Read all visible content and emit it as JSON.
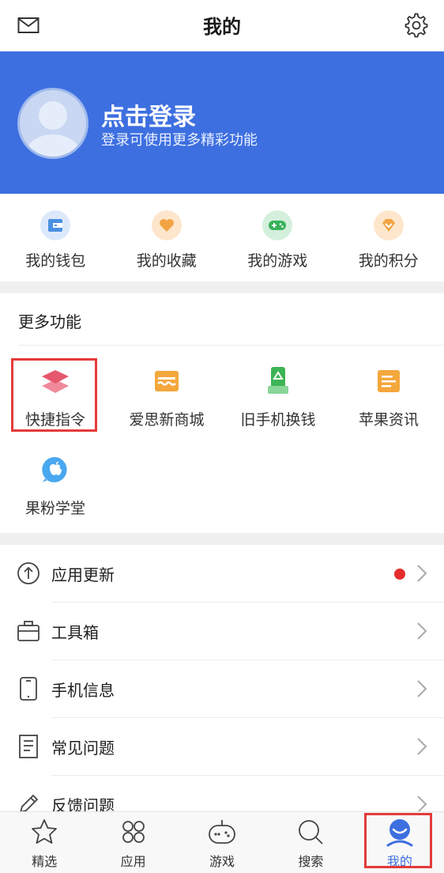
{
  "topbar": {
    "title": "我的"
  },
  "header": {
    "login_title": "点击登录",
    "login_subtitle": "登录可使用更多精彩功能"
  },
  "quick": [
    {
      "label": "我的钱包",
      "icon": "wallet-icon"
    },
    {
      "label": "我的收藏",
      "icon": "heart-icon"
    },
    {
      "label": "我的游戏",
      "icon": "gamepad-icon"
    },
    {
      "label": "我的积分",
      "icon": "points-icon"
    }
  ],
  "more": {
    "title": "更多功能",
    "items": [
      {
        "label": "快捷指令",
        "icon": "shortcuts-layers-icon"
      },
      {
        "label": "爱思新商城",
        "icon": "store-icon"
      },
      {
        "label": "旧手机换钱",
        "icon": "recycle-phone-icon"
      },
      {
        "label": "苹果资讯",
        "icon": "news-icon"
      },
      {
        "label": "果粉学堂",
        "icon": "apple-school-icon"
      }
    ]
  },
  "list": [
    {
      "label": "应用更新",
      "icon": "upload-arrow-icon",
      "has_dot": true
    },
    {
      "label": "工具箱",
      "icon": "toolbox-icon"
    },
    {
      "label": "手机信息",
      "icon": "phone-icon"
    },
    {
      "label": "常见问题",
      "icon": "document-icon"
    },
    {
      "label": "反馈问题",
      "icon": "pencil-icon"
    }
  ],
  "tabs": [
    {
      "label": "精选",
      "icon": "star-icon"
    },
    {
      "label": "应用",
      "icon": "apps-grid-icon"
    },
    {
      "label": "游戏",
      "icon": "game-robot-icon"
    },
    {
      "label": "搜索",
      "icon": "search-icon"
    },
    {
      "label": "我的",
      "icon": "profile-icon",
      "active": true
    }
  ],
  "colors": {
    "brand_blue": "#3d6fe0",
    "highlight_red": "#e53a3a",
    "badge_red": "#e52d2d"
  }
}
